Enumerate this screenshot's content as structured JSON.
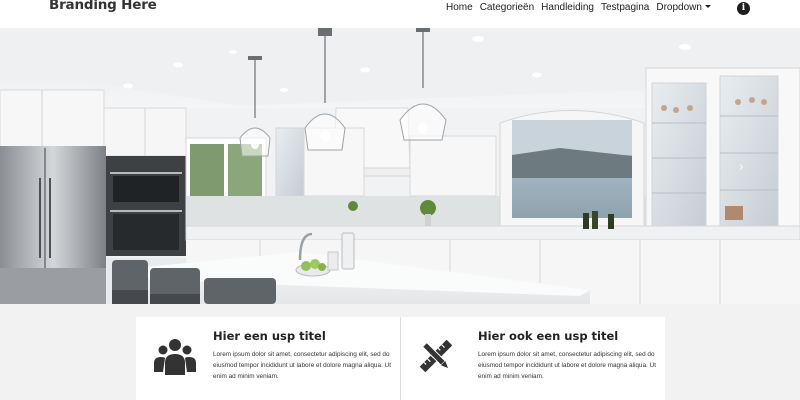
{
  "brand": {
    "name": "Branding Here"
  },
  "nav": {
    "items": [
      {
        "label": "Home"
      },
      {
        "label": "Categorieën"
      },
      {
        "label": "Handleiding"
      },
      {
        "label": "Testpagina"
      },
      {
        "label": "Dropdown"
      }
    ],
    "info_icon": "info-circle-icon"
  },
  "hero": {
    "image": "kitchen-photo",
    "next_icon": "chevron-right-icon"
  },
  "usps": [
    {
      "icon": "users-icon",
      "title": "Hier een usp titel",
      "text": "Lorem ipsum dolor sit amet, consectetur adipiscing elit, sed do eiusmod tempor incididunt ut labore et dolore magna aliqua. Ut enim ad minim veniam."
    },
    {
      "icon": "pencil-ruler-icon",
      "title": "Hier ook een usp titel",
      "text": "Lorem ipsum dolor sit amet, consectetur adipiscing elit, sed do eiusmod tempor incididunt ut labore et dolore magna aliqua. Ut enim ad minim veniam."
    }
  ],
  "colors": {
    "nav_bg": "#ffffff",
    "section_bg": "#f2f2f2",
    "text": "#333333"
  }
}
